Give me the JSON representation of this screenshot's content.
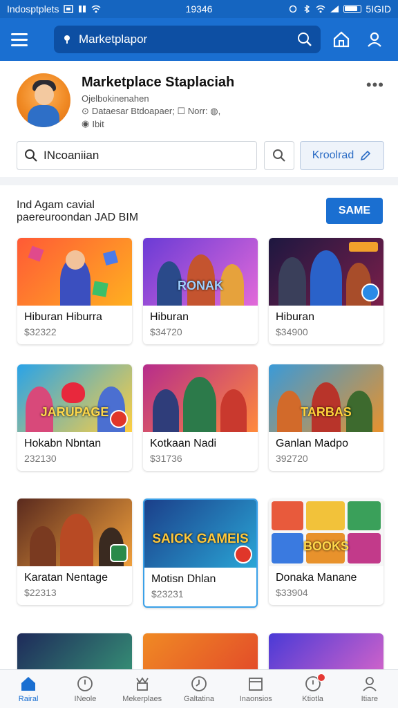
{
  "status_bar": {
    "carrier": "Indosptplets",
    "time": "19346",
    "battery": "5IGID"
  },
  "app_bar": {
    "search_text": "Marketplapor"
  },
  "profile": {
    "title": "Marketplace Staplaciah",
    "line1": "Ojelbokinenahen",
    "line2": "Dataesar Btdoapaer; ☐ Norr: ◍,",
    "line3": "Ibit"
  },
  "search": {
    "value": "INcoaniian"
  },
  "outline_button": {
    "label": "Kroolrad"
  },
  "section": {
    "line1": "Ind Agam cavial",
    "line2": "paereuroondan JAD BIM",
    "button_label": "SAME"
  },
  "cards": [
    {
      "name": "Hiburan Hiburra",
      "price": "$32322",
      "art": ""
    },
    {
      "name": "Hiburan",
      "price": "$34720",
      "art": "RONAK"
    },
    {
      "name": "Hiburan",
      "price": "$34900",
      "art": ""
    },
    {
      "name": "Hokabn Nbntan",
      "price": "232130",
      "art": "JARUPAGE"
    },
    {
      "name": "Kotkaan Nadi",
      "price": "$31736",
      "art": ""
    },
    {
      "name": "Ganlan Madpo",
      "price": "392720",
      "art": "TARBAS"
    },
    {
      "name": "Karatan Nentage",
      "price": "$22313",
      "art": ""
    },
    {
      "name": "Motisn Dhlan",
      "price": "$23231",
      "art": "SAICK GAMEIS"
    },
    {
      "name": "Donaka Manane",
      "price": "$33904",
      "art": "BOOKS"
    },
    {
      "name": "",
      "price": "",
      "art": ""
    },
    {
      "name": "",
      "price": "",
      "art": ""
    },
    {
      "name": "",
      "price": "",
      "art": ""
    }
  ],
  "nav": [
    {
      "label": "Rairal",
      "icon": "home-icon",
      "active": true
    },
    {
      "label": "INeole",
      "icon": "compass-icon"
    },
    {
      "label": "Mekerplaes",
      "icon": "store-icon"
    },
    {
      "label": "Galtatina",
      "icon": "clock-icon"
    },
    {
      "label": "Inaonsios",
      "icon": "calendar-icon"
    },
    {
      "label": "Ktiotla",
      "icon": "notification-icon",
      "badge": true
    },
    {
      "label": "Itiare",
      "icon": "profile-icon"
    }
  ],
  "colors": {
    "primary": "#1a6fd1",
    "primary_dark": "#0d4fa3",
    "badge": "#e53935"
  }
}
